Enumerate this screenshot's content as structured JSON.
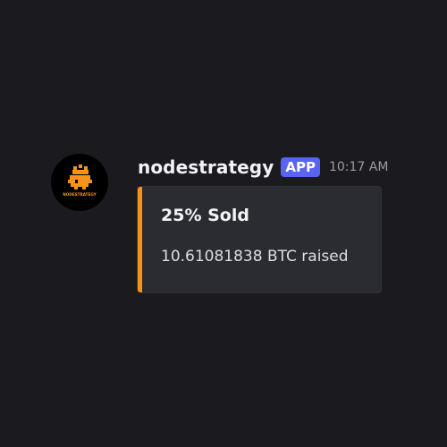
{
  "message": {
    "author": {
      "username": "nodestrategy",
      "badge": "APP",
      "avatar_icon": "nodestrategy-logo-icon",
      "avatar_text": "NODESTRATEGY"
    },
    "timestamp": "10:17 AM",
    "embed": {
      "accent_color": "#f7931a",
      "title": "25% Sold",
      "description": "10.61081838 BTC raised"
    }
  },
  "colors": {
    "background": "#1b1b1f",
    "embed_background": "#2b2c31",
    "badge": "#5865f2",
    "brand_orange": "#f7931a"
  }
}
